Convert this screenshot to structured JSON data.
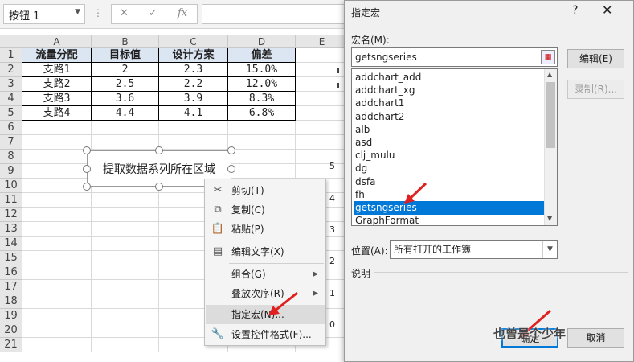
{
  "name_box": {
    "value": "按钮 1"
  },
  "formula_bar": {
    "cancel_icon": "✕",
    "confirm_icon": "✓",
    "fx_icon": "fx"
  },
  "sheet": {
    "columns": [
      "A",
      "B",
      "C",
      "D",
      "E"
    ],
    "rows": [
      "1",
      "2",
      "3",
      "4",
      "5",
      "6",
      "7",
      "8",
      "9",
      "10",
      "11",
      "12",
      "13",
      "14",
      "15",
      "16",
      "17",
      "18",
      "19",
      "20",
      "21"
    ],
    "table": {
      "headers": [
        "流量分配",
        "目标值",
        "设计方案",
        "偏差"
      ],
      "rows": [
        [
          "支路1",
          "2",
          "2.3",
          "15.0%"
        ],
        [
          "支路2",
          "2.5",
          "2.2",
          "12.0%"
        ],
        [
          "支路3",
          "3.6",
          "3.9",
          "8.3%"
        ],
        [
          "支路4",
          "4.4",
          "4.1",
          "6.8%"
        ]
      ]
    },
    "form_button_label": "提取数据系列所在区域",
    "axis_ticks": [
      "5",
      "4",
      "3",
      "2",
      "1",
      "0"
    ]
  },
  "context_menu": {
    "items": [
      {
        "label": "剪切(T)",
        "icon": "scissors-icon"
      },
      {
        "label": "复制(C)",
        "icon": "copy-icon"
      },
      {
        "label": "粘贴(P)",
        "icon": "paste-icon"
      },
      {
        "label": "编辑文字(X)",
        "icon": "text-edit-icon"
      },
      {
        "label": "组合(G)",
        "icon": ""
      },
      {
        "label": "叠放次序(R)",
        "icon": ""
      },
      {
        "label": "指定宏(N)...",
        "icon": ""
      },
      {
        "label": "设置控件格式(F)...",
        "icon": "format-icon"
      }
    ]
  },
  "dialog": {
    "title": "指定宏",
    "help": "?",
    "close": "✕",
    "macro_name_label": "宏名(M):",
    "macro_name_value": "getsngseries",
    "macros": [
      "addchart_add",
      "addchart_xg",
      "addchart1",
      "addchart2",
      "alb",
      "asd",
      "clj_mulu",
      "dg",
      "dsfa",
      "fh",
      "getsngseries",
      "GraphFormat"
    ],
    "selected_macro": "getsngseries",
    "edit_button": "编辑(E)",
    "record_button": "录制(R)...",
    "location_label": "位置(A):",
    "location_value": "所有打开的工作簿",
    "description_label": "说明",
    "ok_button": "确定",
    "cancel_button": "取消"
  },
  "watermark": "也曾是个少年",
  "colors": {
    "selection": "#0078d7",
    "header_fill": "#dce6f2",
    "arrow": "#e02020"
  }
}
